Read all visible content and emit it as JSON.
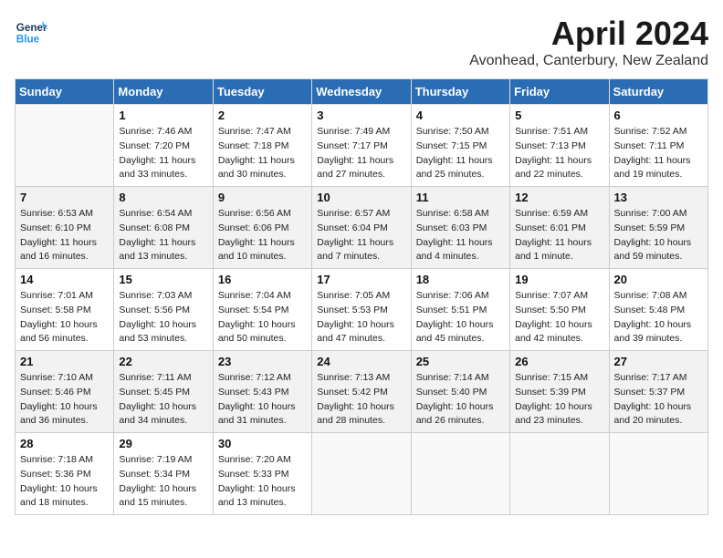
{
  "header": {
    "logo_line1": "General",
    "logo_line2": "Blue",
    "month_title": "April 2024",
    "location": "Avonhead, Canterbury, New Zealand"
  },
  "days_of_week": [
    "Sunday",
    "Monday",
    "Tuesday",
    "Wednesday",
    "Thursday",
    "Friday",
    "Saturday"
  ],
  "weeks": [
    [
      {
        "day": "",
        "info": ""
      },
      {
        "day": "1",
        "info": "Sunrise: 7:46 AM\nSunset: 7:20 PM\nDaylight: 11 hours\nand 33 minutes."
      },
      {
        "day": "2",
        "info": "Sunrise: 7:47 AM\nSunset: 7:18 PM\nDaylight: 11 hours\nand 30 minutes."
      },
      {
        "day": "3",
        "info": "Sunrise: 7:49 AM\nSunset: 7:17 PM\nDaylight: 11 hours\nand 27 minutes."
      },
      {
        "day": "4",
        "info": "Sunrise: 7:50 AM\nSunset: 7:15 PM\nDaylight: 11 hours\nand 25 minutes."
      },
      {
        "day": "5",
        "info": "Sunrise: 7:51 AM\nSunset: 7:13 PM\nDaylight: 11 hours\nand 22 minutes."
      },
      {
        "day": "6",
        "info": "Sunrise: 7:52 AM\nSunset: 7:11 PM\nDaylight: 11 hours\nand 19 minutes."
      }
    ],
    [
      {
        "day": "7",
        "info": "Sunrise: 6:53 AM\nSunset: 6:10 PM\nDaylight: 11 hours\nand 16 minutes."
      },
      {
        "day": "8",
        "info": "Sunrise: 6:54 AM\nSunset: 6:08 PM\nDaylight: 11 hours\nand 13 minutes."
      },
      {
        "day": "9",
        "info": "Sunrise: 6:56 AM\nSunset: 6:06 PM\nDaylight: 11 hours\nand 10 minutes."
      },
      {
        "day": "10",
        "info": "Sunrise: 6:57 AM\nSunset: 6:04 PM\nDaylight: 11 hours\nand 7 minutes."
      },
      {
        "day": "11",
        "info": "Sunrise: 6:58 AM\nSunset: 6:03 PM\nDaylight: 11 hours\nand 4 minutes."
      },
      {
        "day": "12",
        "info": "Sunrise: 6:59 AM\nSunset: 6:01 PM\nDaylight: 11 hours\nand 1 minute."
      },
      {
        "day": "13",
        "info": "Sunrise: 7:00 AM\nSunset: 5:59 PM\nDaylight: 10 hours\nand 59 minutes."
      }
    ],
    [
      {
        "day": "14",
        "info": "Sunrise: 7:01 AM\nSunset: 5:58 PM\nDaylight: 10 hours\nand 56 minutes."
      },
      {
        "day": "15",
        "info": "Sunrise: 7:03 AM\nSunset: 5:56 PM\nDaylight: 10 hours\nand 53 minutes."
      },
      {
        "day": "16",
        "info": "Sunrise: 7:04 AM\nSunset: 5:54 PM\nDaylight: 10 hours\nand 50 minutes."
      },
      {
        "day": "17",
        "info": "Sunrise: 7:05 AM\nSunset: 5:53 PM\nDaylight: 10 hours\nand 47 minutes."
      },
      {
        "day": "18",
        "info": "Sunrise: 7:06 AM\nSunset: 5:51 PM\nDaylight: 10 hours\nand 45 minutes."
      },
      {
        "day": "19",
        "info": "Sunrise: 7:07 AM\nSunset: 5:50 PM\nDaylight: 10 hours\nand 42 minutes."
      },
      {
        "day": "20",
        "info": "Sunrise: 7:08 AM\nSunset: 5:48 PM\nDaylight: 10 hours\nand 39 minutes."
      }
    ],
    [
      {
        "day": "21",
        "info": "Sunrise: 7:10 AM\nSunset: 5:46 PM\nDaylight: 10 hours\nand 36 minutes."
      },
      {
        "day": "22",
        "info": "Sunrise: 7:11 AM\nSunset: 5:45 PM\nDaylight: 10 hours\nand 34 minutes."
      },
      {
        "day": "23",
        "info": "Sunrise: 7:12 AM\nSunset: 5:43 PM\nDaylight: 10 hours\nand 31 minutes."
      },
      {
        "day": "24",
        "info": "Sunrise: 7:13 AM\nSunset: 5:42 PM\nDaylight: 10 hours\nand 28 minutes."
      },
      {
        "day": "25",
        "info": "Sunrise: 7:14 AM\nSunset: 5:40 PM\nDaylight: 10 hours\nand 26 minutes."
      },
      {
        "day": "26",
        "info": "Sunrise: 7:15 AM\nSunset: 5:39 PM\nDaylight: 10 hours\nand 23 minutes."
      },
      {
        "day": "27",
        "info": "Sunrise: 7:17 AM\nSunset: 5:37 PM\nDaylight: 10 hours\nand 20 minutes."
      }
    ],
    [
      {
        "day": "28",
        "info": "Sunrise: 7:18 AM\nSunset: 5:36 PM\nDaylight: 10 hours\nand 18 minutes."
      },
      {
        "day": "29",
        "info": "Sunrise: 7:19 AM\nSunset: 5:34 PM\nDaylight: 10 hours\nand 15 minutes."
      },
      {
        "day": "30",
        "info": "Sunrise: 7:20 AM\nSunset: 5:33 PM\nDaylight: 10 hours\nand 13 minutes."
      },
      {
        "day": "",
        "info": ""
      },
      {
        "day": "",
        "info": ""
      },
      {
        "day": "",
        "info": ""
      },
      {
        "day": "",
        "info": ""
      }
    ]
  ]
}
